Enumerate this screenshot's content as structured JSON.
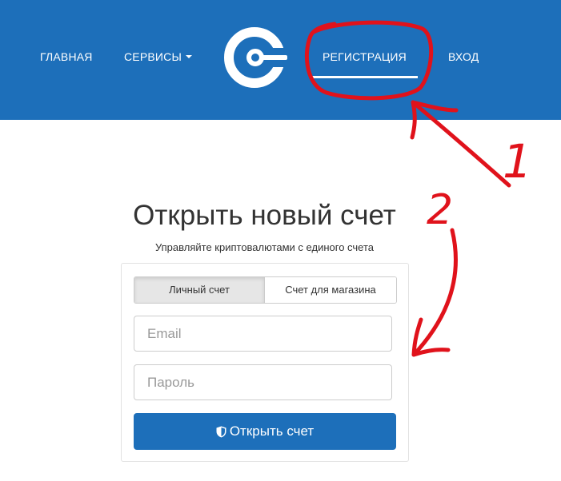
{
  "nav": {
    "home": "ГЛАВНАЯ",
    "services": "СЕРВИСЫ",
    "register": "РЕГИСТРАЦИЯ",
    "login": "ВХОД",
    "active_item": "РЕГИСТРАЦИЯ"
  },
  "logo_icon": "coin-c-logo-icon",
  "form": {
    "title": "Открыть новый счет",
    "subtitle": "Управляйте криптовалютами с единого счета",
    "tabs": [
      {
        "label": "Личный счет",
        "selected": true
      },
      {
        "label": "Счет для магазина",
        "selected": false
      }
    ],
    "email_placeholder": "Email",
    "email_value": "",
    "password_placeholder": "Пароль",
    "password_value": "",
    "submit_label": "Открыть счет",
    "submit_icon": "shield-icon"
  },
  "annotations": {
    "label_1": "1",
    "label_2": "2",
    "color": "#e0121b"
  },
  "colors": {
    "brand_blue": "#1d6fba",
    "text": "#333333",
    "placeholder": "#999999"
  }
}
